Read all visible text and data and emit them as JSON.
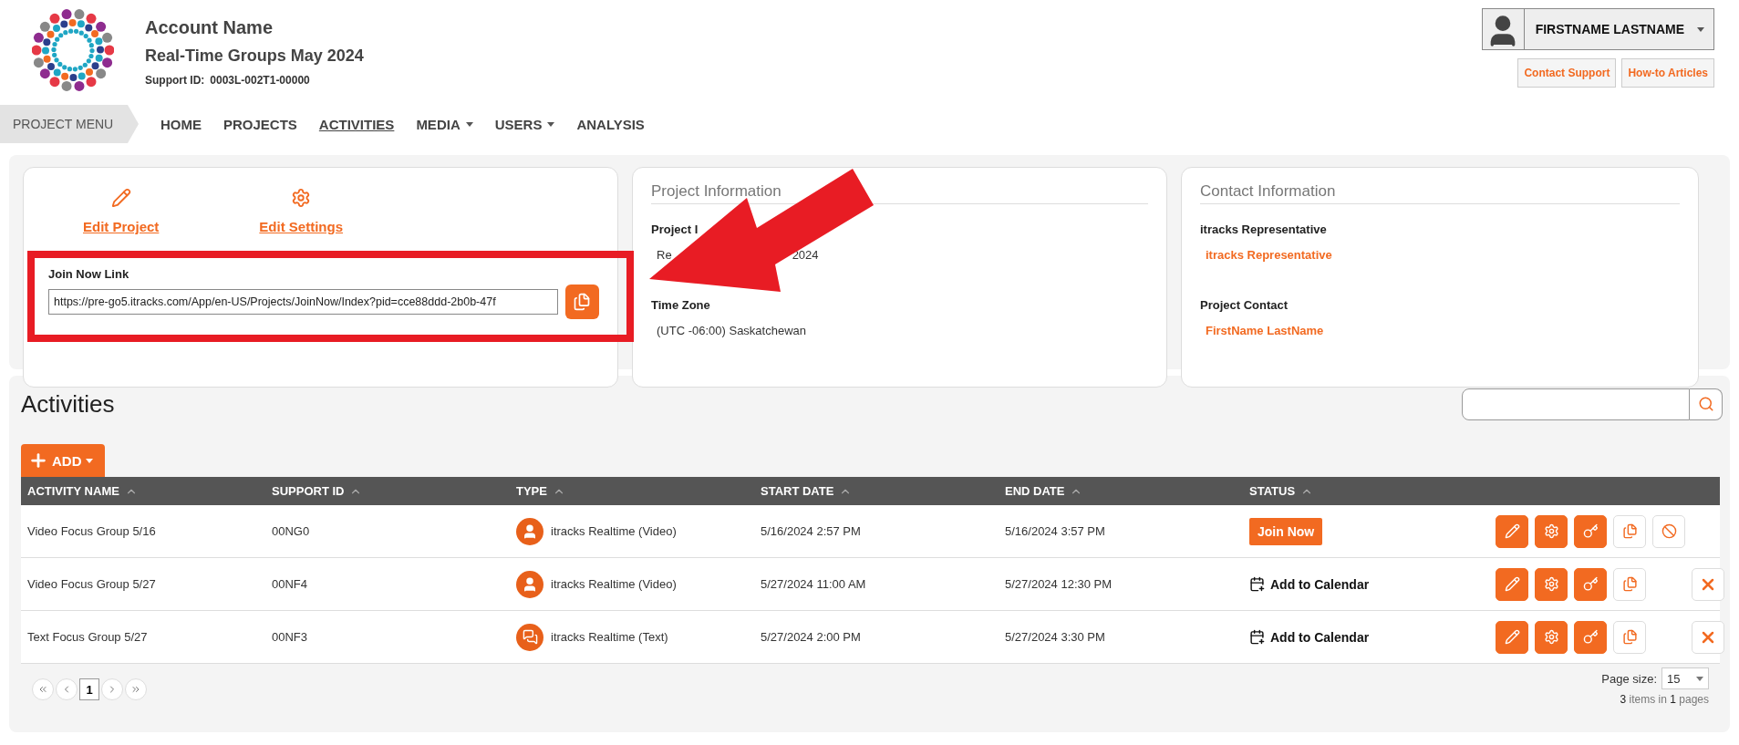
{
  "header": {
    "account_name": "Account Name",
    "project_name": "Real-Time Groups May 2024",
    "support_id_label": "Support ID:",
    "support_id": "0003L-002T1-00000"
  },
  "user_menu": {
    "name": "FIRSTNAME LASTNAME"
  },
  "header_links": [
    "Contact Support",
    "How-to Articles"
  ],
  "nav": {
    "menu_label": "PROJECT MENU",
    "items": [
      {
        "label": "HOME",
        "selected": false,
        "dropdown": false
      },
      {
        "label": "PROJECTS",
        "selected": false,
        "dropdown": false
      },
      {
        "label": "ACTIVITIES",
        "selected": true,
        "dropdown": false
      },
      {
        "label": "MEDIA",
        "selected": false,
        "dropdown": true
      },
      {
        "label": "USERS",
        "selected": false,
        "dropdown": true
      },
      {
        "label": "ANALYSIS",
        "selected": false,
        "dropdown": false
      }
    ]
  },
  "actions_card": {
    "links": [
      {
        "kind": "edit",
        "label": "Edit Project"
      },
      {
        "kind": "settings",
        "label": "Edit Settings"
      }
    ],
    "join_link": {
      "label": "Join Now Link",
      "value": "https://pre-go5.itracks.com/App/en-US/Projects/JoinNow/Index?pid=cce88ddd-2b0b-47f"
    }
  },
  "project_info": {
    "title": "Project Information",
    "fields": [
      {
        "label": "Project I",
        "value_parts": [
          "Re",
          "2024"
        ]
      },
      {
        "label": "Time Zone",
        "value_parts": [
          "(UTC -06:00) Saskatchewan"
        ]
      }
    ]
  },
  "contact_info": {
    "title": "Contact Information",
    "fields": [
      {
        "label": "itracks Representative",
        "value": "itracks Representative"
      },
      {
        "label": "Project Contact",
        "value": "FirstName LastName"
      }
    ]
  },
  "activities": {
    "title": "Activities",
    "add_label": "ADD",
    "columns": [
      "ACTIVITY NAME",
      "SUPPORT ID",
      "TYPE",
      "START DATE",
      "END DATE",
      "STATUS"
    ],
    "rows": [
      {
        "name": "Video Focus Group 5/16",
        "support_id": "00NG0",
        "type": {
          "kind": "video",
          "label": "itracks Realtime (Video)"
        },
        "start": "5/16/2024 2:57 PM",
        "end": "5/16/2024 3:57 PM",
        "status": {
          "kind": "join",
          "label": "Join Now"
        },
        "trailing": {
          "kind": "disable"
        }
      },
      {
        "name": "Video Focus Group 5/27",
        "support_id": "00NF4",
        "type": {
          "kind": "video",
          "label": "itracks Realtime (Video)"
        },
        "start": "5/27/2024 11:00 AM",
        "end": "5/27/2024 12:30 PM",
        "status": {
          "kind": "calendar",
          "label": "Add to Calendar"
        },
        "trailing": {
          "kind": "delete"
        }
      },
      {
        "name": "Text Focus Group 5/27",
        "support_id": "00NF3",
        "type": {
          "kind": "text",
          "label": "itracks Realtime (Text)"
        },
        "start": "5/27/2024 2:00 PM",
        "end": "5/27/2024 3:30 PM",
        "status": {
          "kind": "calendar",
          "label": "Add to Calendar"
        },
        "trailing": {
          "kind": "delete"
        }
      }
    ],
    "pages": [
      {
        "label": "1",
        "selected": true
      }
    ],
    "page_size_label": "Page size:",
    "page_size": "15",
    "summary": "**3** items in **1** pages"
  }
}
